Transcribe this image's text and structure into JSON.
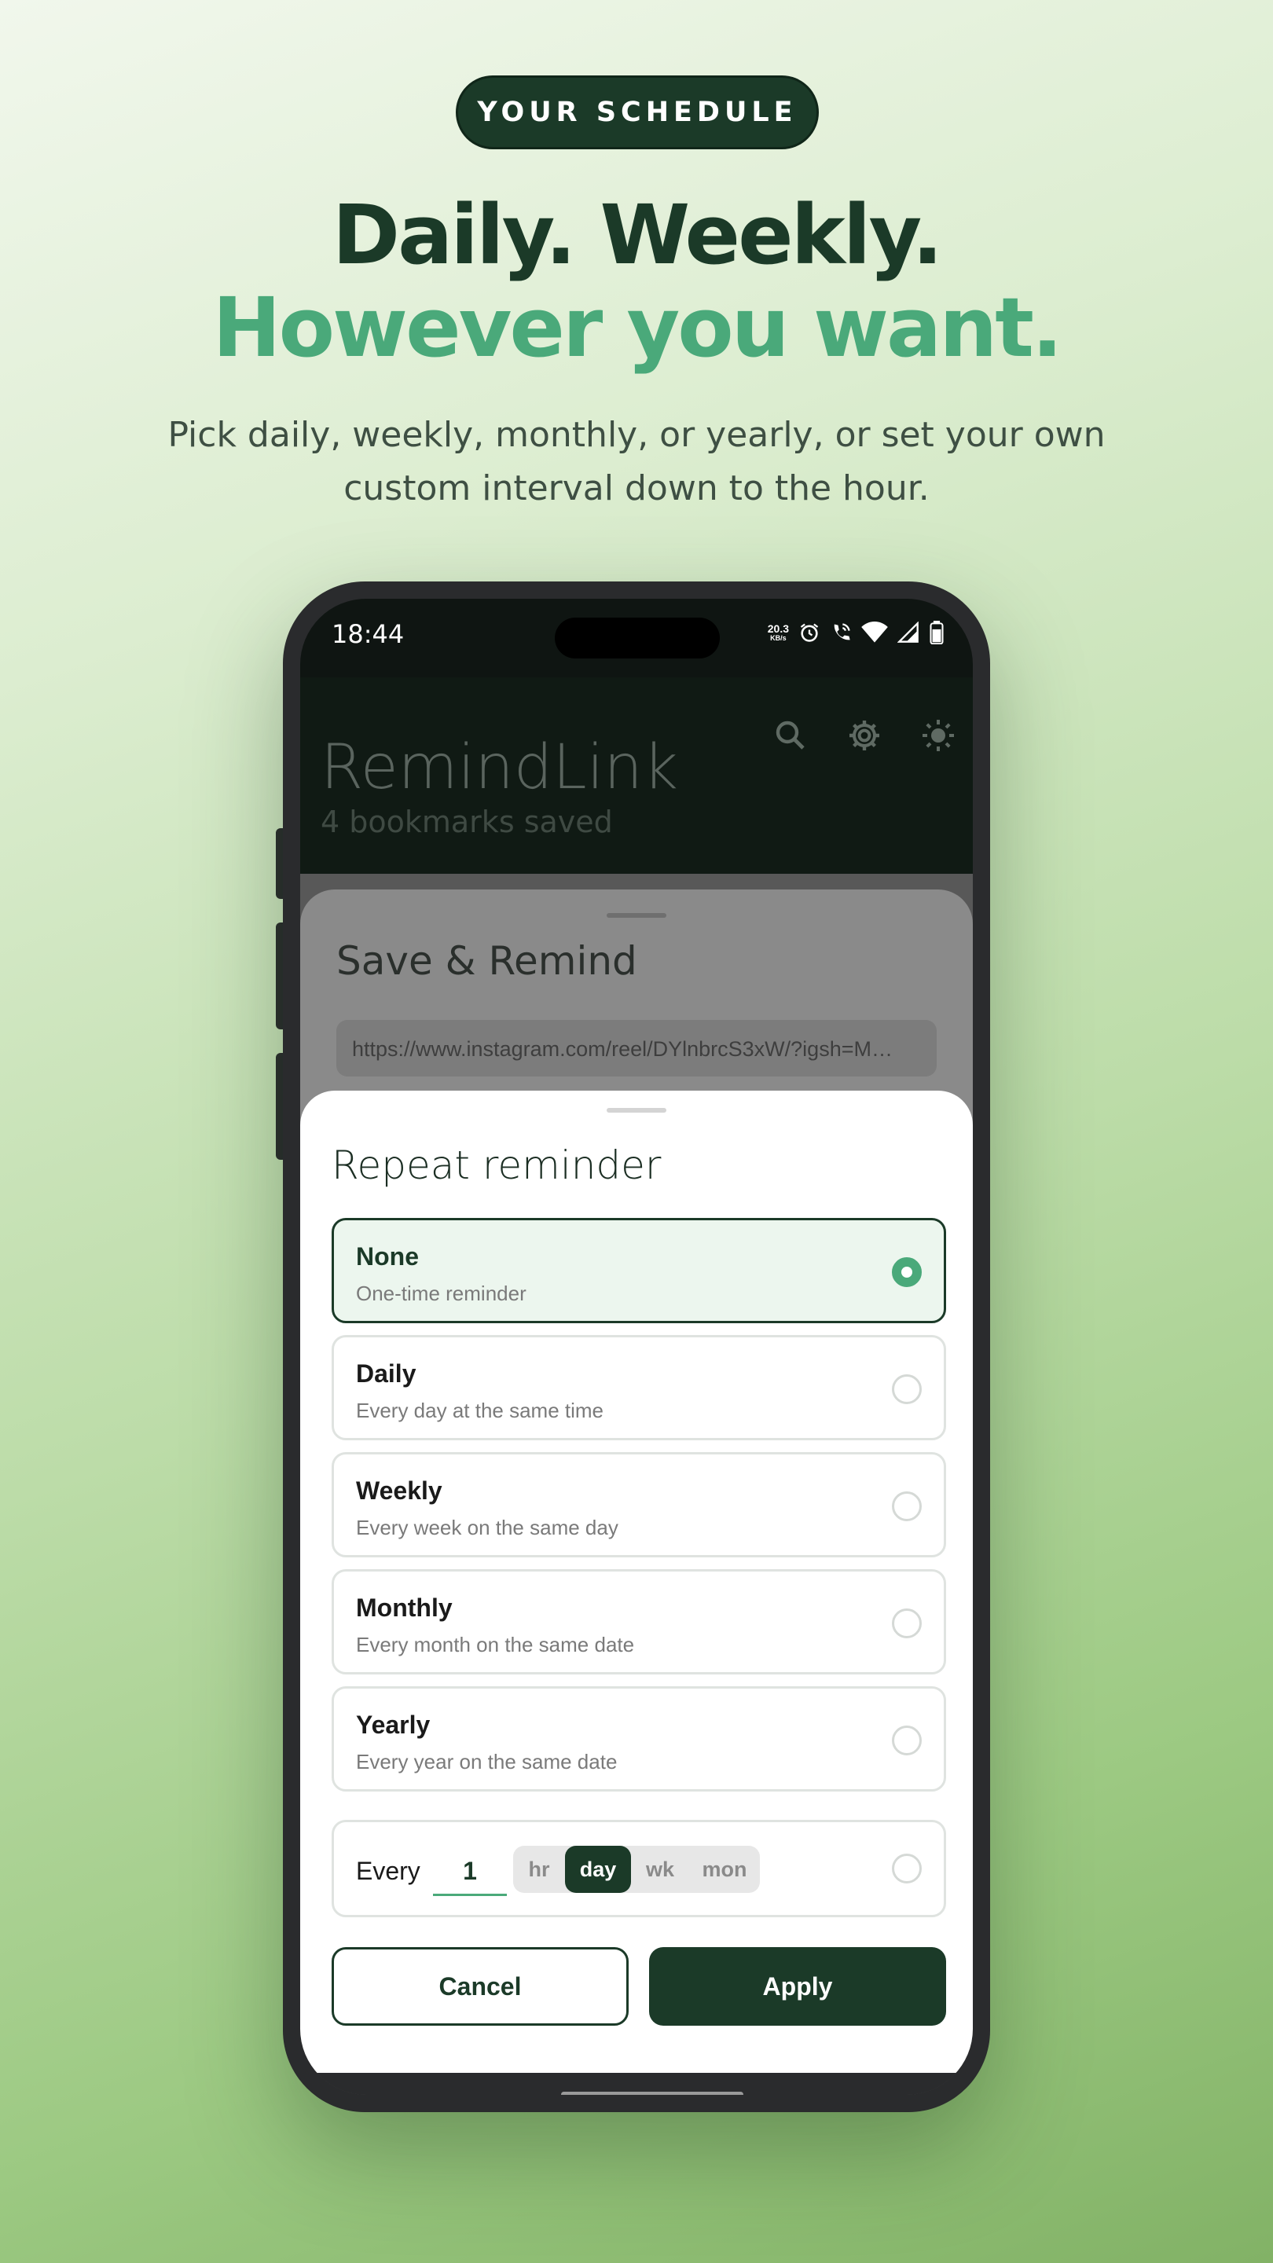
{
  "marketing": {
    "badge": "YOUR SCHEDULE",
    "headline_line1": "Daily. Weekly.",
    "headline_line2": "However you want.",
    "subtitle_line1": "Pick daily, weekly, monthly, or yearly, or set your own",
    "subtitle_line2": "custom interval down to the hour."
  },
  "status_bar": {
    "time": "18:44",
    "net_speed_value": "20.3",
    "net_speed_unit": "KB/s",
    "icons": [
      "alarm-icon",
      "wifi-call-icon",
      "wifi-icon",
      "signal-icon",
      "battery-icon"
    ]
  },
  "app": {
    "title": "RemindLink",
    "subtitle": "4 bookmarks saved",
    "header_icons": [
      "search-icon",
      "gear-icon",
      "theme-sun-icon"
    ]
  },
  "save_sheet": {
    "title": "Save & Remind",
    "url_value": "https://www.instagram.com/reel/DYlnbrcS3xW/?igsh=M…"
  },
  "repeat_sheet": {
    "title": "Repeat reminder",
    "options": [
      {
        "label": "None",
        "description": "One-time reminder",
        "selected": true
      },
      {
        "label": "Daily",
        "description": "Every day at the same time",
        "selected": false
      },
      {
        "label": "Weekly",
        "description": "Every week on the same day",
        "selected": false
      },
      {
        "label": "Monthly",
        "description": "Every month on the same date",
        "selected": false
      },
      {
        "label": "Yearly",
        "description": "Every year on the same date",
        "selected": false
      }
    ],
    "custom": {
      "label": "Every",
      "value": "1",
      "units": [
        "hr",
        "day",
        "wk",
        "mon"
      ],
      "active_unit": "day",
      "selected": false
    },
    "cancel_label": "Cancel",
    "apply_label": "Apply"
  },
  "colors": {
    "brand_dark": "#1b3a28",
    "accent_green": "#4aa97a",
    "selected_bg": "#ecf6ee"
  }
}
